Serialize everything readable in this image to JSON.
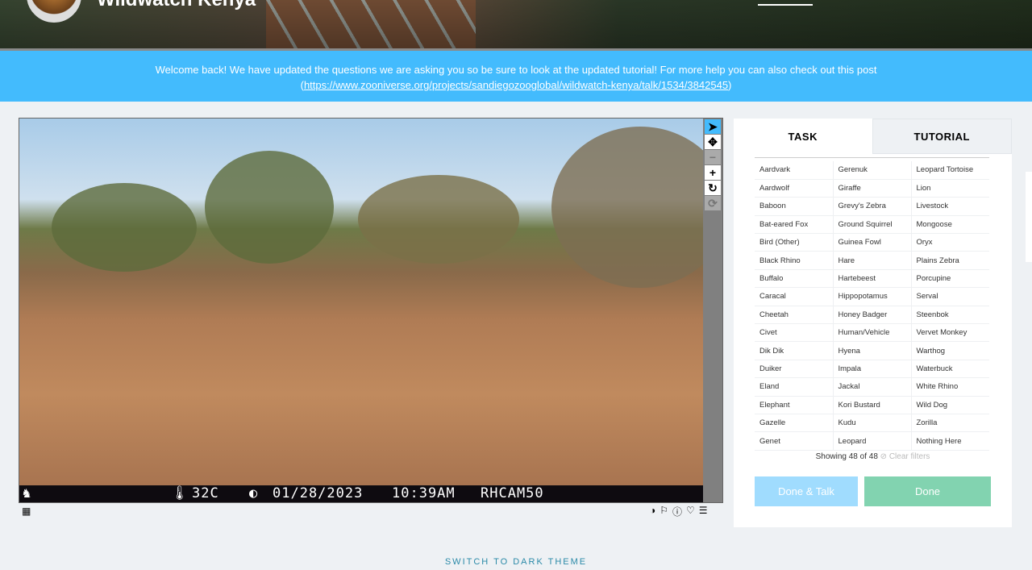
{
  "header": {
    "title": "Wildwatch Kenya"
  },
  "banner": {
    "message": "Welcome back! We have updated the questions we are asking you so be sure to look at the updated tutorial! For more help you can also check out this post",
    "link": "https://www.zooniverse.org/projects/sandiegozooglobal/wildwatch-kenya/talk/1534/3842545"
  },
  "camera": {
    "temperature": "32C",
    "date": "01/28/2023",
    "time": "10:39AM",
    "camera_id": "RHCAM50"
  },
  "tabs": [
    "TASK",
    "TUTORIAL"
  ],
  "species_rows": [
    [
      "Aardvark",
      "Gerenuk",
      "Leopard Tortoise"
    ],
    [
      "Aardwolf",
      "Giraffe",
      "Lion"
    ],
    [
      "Baboon",
      "Grevy's Zebra",
      "Livestock"
    ],
    [
      "Bat-eared Fox",
      "Ground Squirrel",
      "Mongoose"
    ],
    [
      "Bird (Other)",
      "Guinea Fowl",
      "Oryx"
    ],
    [
      "Black Rhino",
      "Hare",
      "Plains Zebra"
    ],
    [
      "Buffalo",
      "Hartebeest",
      "Porcupine"
    ],
    [
      "Caracal",
      "Hippopotamus",
      "Serval"
    ],
    [
      "Cheetah",
      "Honey Badger",
      "Steenbok"
    ],
    [
      "Civet",
      "Human/Vehicle",
      "Vervet Monkey"
    ],
    [
      "Dik Dik",
      "Hyena",
      "Warthog"
    ],
    [
      "Duiker",
      "Impala",
      "Waterbuck"
    ],
    [
      "Eland",
      "Jackal",
      "White Rhino"
    ],
    [
      "Elephant",
      "Kori Bustard",
      "Wild Dog"
    ],
    [
      "Gazelle",
      "Kudu",
      "Zorilla"
    ],
    [
      "Genet",
      "Leopard",
      "Nothing Here"
    ]
  ],
  "filter": {
    "showing": "Showing 48 of 48",
    "clear": "Clear filters"
  },
  "buttons": {
    "done_talk": "Done & Talk",
    "done": "Done"
  },
  "footer": {
    "theme": "SWITCH TO DARK THEME"
  },
  "colors": {
    "accent": "#43bbfd",
    "done": "#82d3b0",
    "done_talk": "#a0dcfe"
  }
}
